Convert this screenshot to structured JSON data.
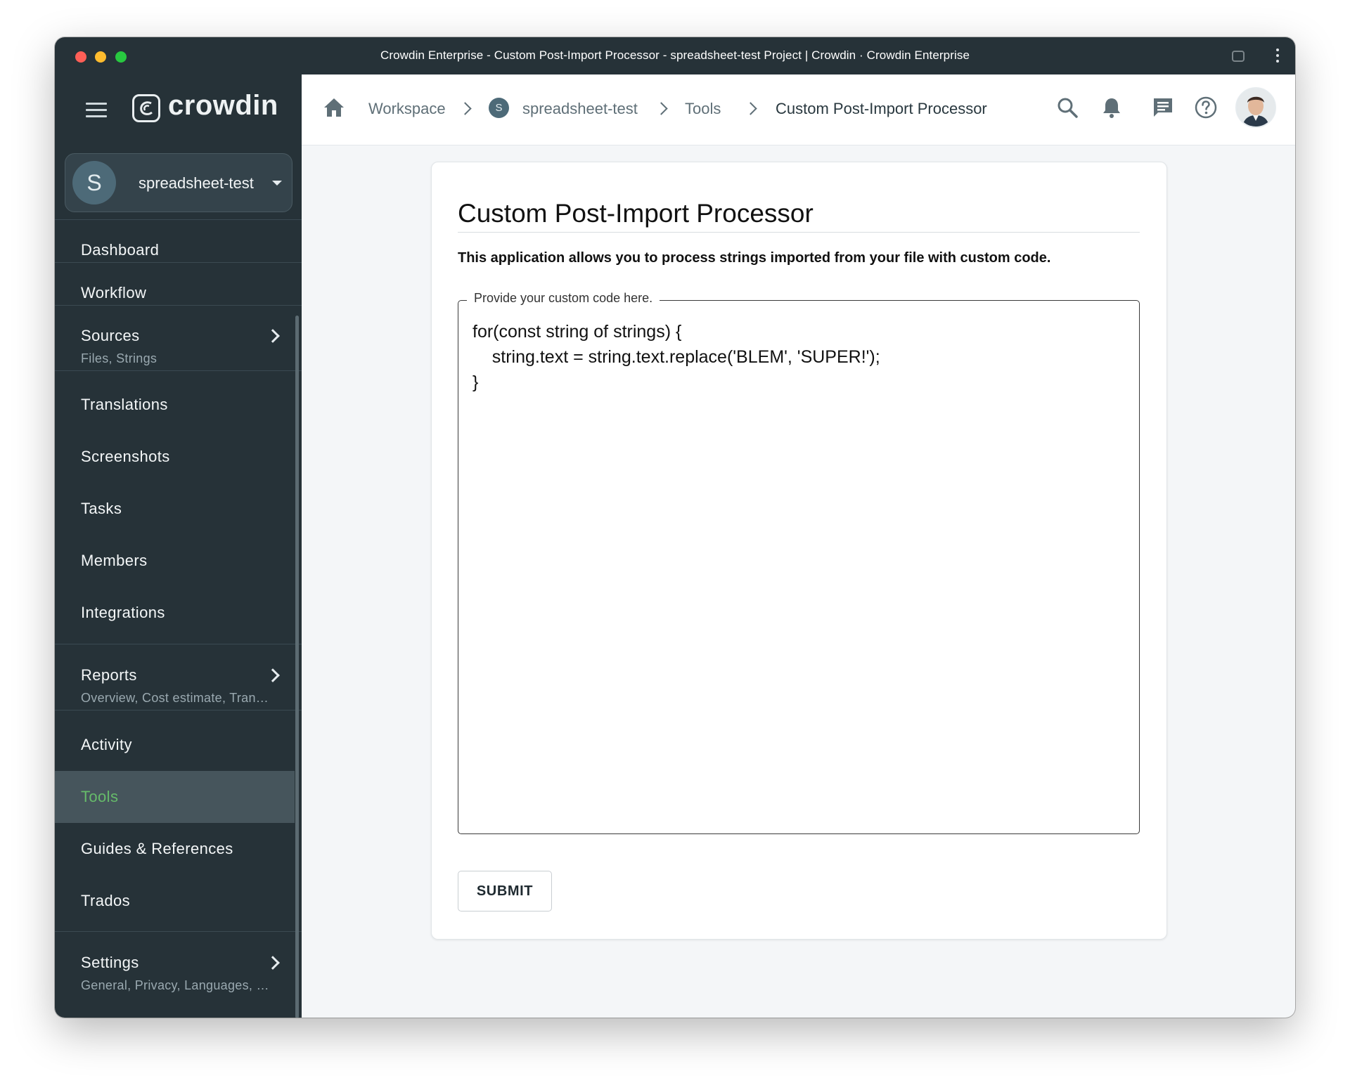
{
  "window": {
    "title": "Crowdin Enterprise - Custom Post-Import Processor - spreadsheet-test Project | Crowdin · Crowdin Enterprise"
  },
  "sidebar": {
    "logo_text": "crowdin",
    "project": {
      "avatar_letter": "S",
      "name": "spreadsheet-test"
    },
    "items": [
      {
        "label": "Dashboard"
      },
      {
        "label": "Workflow"
      },
      {
        "label": "Sources",
        "sub": "Files, Strings"
      },
      {
        "label": "Translations"
      },
      {
        "label": "Screenshots"
      },
      {
        "label": "Tasks"
      },
      {
        "label": "Members"
      },
      {
        "label": "Integrations"
      },
      {
        "label": "Reports",
        "sub": "Overview, Cost estimate, Tran…"
      },
      {
        "label": "Activity"
      },
      {
        "label": "Tools",
        "active": true
      },
      {
        "label": "Guides & References"
      },
      {
        "label": "Trados"
      },
      {
        "label": "Settings",
        "sub": "General, Privacy, Languages, …"
      }
    ]
  },
  "breadcrumb": {
    "workspace": "Workspace",
    "project_avatar_letter": "S",
    "project": "spreadsheet-test",
    "tools": "Tools",
    "current": "Custom Post-Import Processor"
  },
  "main": {
    "title": "Custom Post-Import Processor",
    "description": "This application allows you to process strings imported from your file with custom code.",
    "code_label": "Provide your custom code here.",
    "code": "for(const string of strings) {\n    string.text = string.text.replace('BLEM', 'SUPER!');\n}",
    "submit_label": "SUBMIT"
  },
  "colors": {
    "sidebar_bg": "#263238",
    "active_item_text": "#66bb6a",
    "content_bg": "#f4f6f8"
  }
}
